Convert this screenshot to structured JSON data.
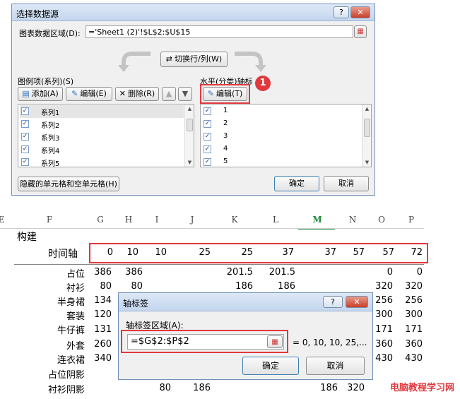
{
  "select_source_dialog": {
    "title": "选择数据源",
    "help": "?",
    "close": "✕",
    "range_label": "图表数据区域(D):",
    "range_value": "='Sheet1 (2)'!$L$2:$U$15",
    "switch_button": "切换行/列(W)",
    "legend_section_label": "图例项(系列)(S)",
    "axis_section_label": "水平(分类)轴标",
    "add_button": "添加(A)",
    "edit_button": "编辑(E)",
    "delete_button": "删除(R)",
    "axis_edit_button": "编辑(T)",
    "series": [
      "系列1",
      "系列2",
      "系列3",
      "系列4",
      "系列5"
    ],
    "axis_labels": [
      "1",
      "2",
      "3",
      "4",
      "5"
    ],
    "hidden_cells_button": "隐藏的单元格和空单元格(H)",
    "ok": "确定",
    "cancel": "取消",
    "step_number": "1"
  },
  "sheet": {
    "col_headers": [
      "E",
      "F",
      "G",
      "H",
      "I",
      "J",
      "K",
      "L",
      "M",
      "N",
      "O",
      "P"
    ],
    "build_label": "构建",
    "timeline_label": "时间轴",
    "timeline_values": [
      "0",
      "10",
      "10",
      "25",
      "25",
      "37",
      "37",
      "57",
      "57",
      "72"
    ],
    "row_labels": [
      "占位",
      "衬衫",
      "半身裙",
      "套装",
      "牛仔裤",
      "外套",
      "连衣裙",
      "占位阴影",
      "衬衫阴影"
    ],
    "values": {
      "r0": [
        "386",
        "386",
        "201.5",
        "201.5",
        "0",
        "0"
      ],
      "r1": [
        "80",
        "80",
        "186",
        "186",
        "320",
        "320"
      ],
      "r2": [
        "134",
        "256",
        "256"
      ],
      "r3": [
        "120",
        "300",
        "300"
      ],
      "r4": [
        "131",
        "171",
        "171"
      ],
      "r5": [
        "260",
        "360",
        "360"
      ],
      "r6": [
        "340",
        "430",
        "430"
      ],
      "r8": [
        "80",
        "186",
        "186",
        "320"
      ]
    }
  },
  "axis_dialog": {
    "title": "轴标签",
    "help": "?",
    "close": "✕",
    "range_label": "轴标签区域(A):",
    "range_value": "=$G$2:$P$2",
    "preview": "= 0, 10, 10, 25,...",
    "ok": "确定",
    "cancel": "取消"
  },
  "watermark": "电脑教程学习网",
  "colors": {
    "highlight": "#e0393e",
    "selected_col": "#1e8a3a"
  }
}
